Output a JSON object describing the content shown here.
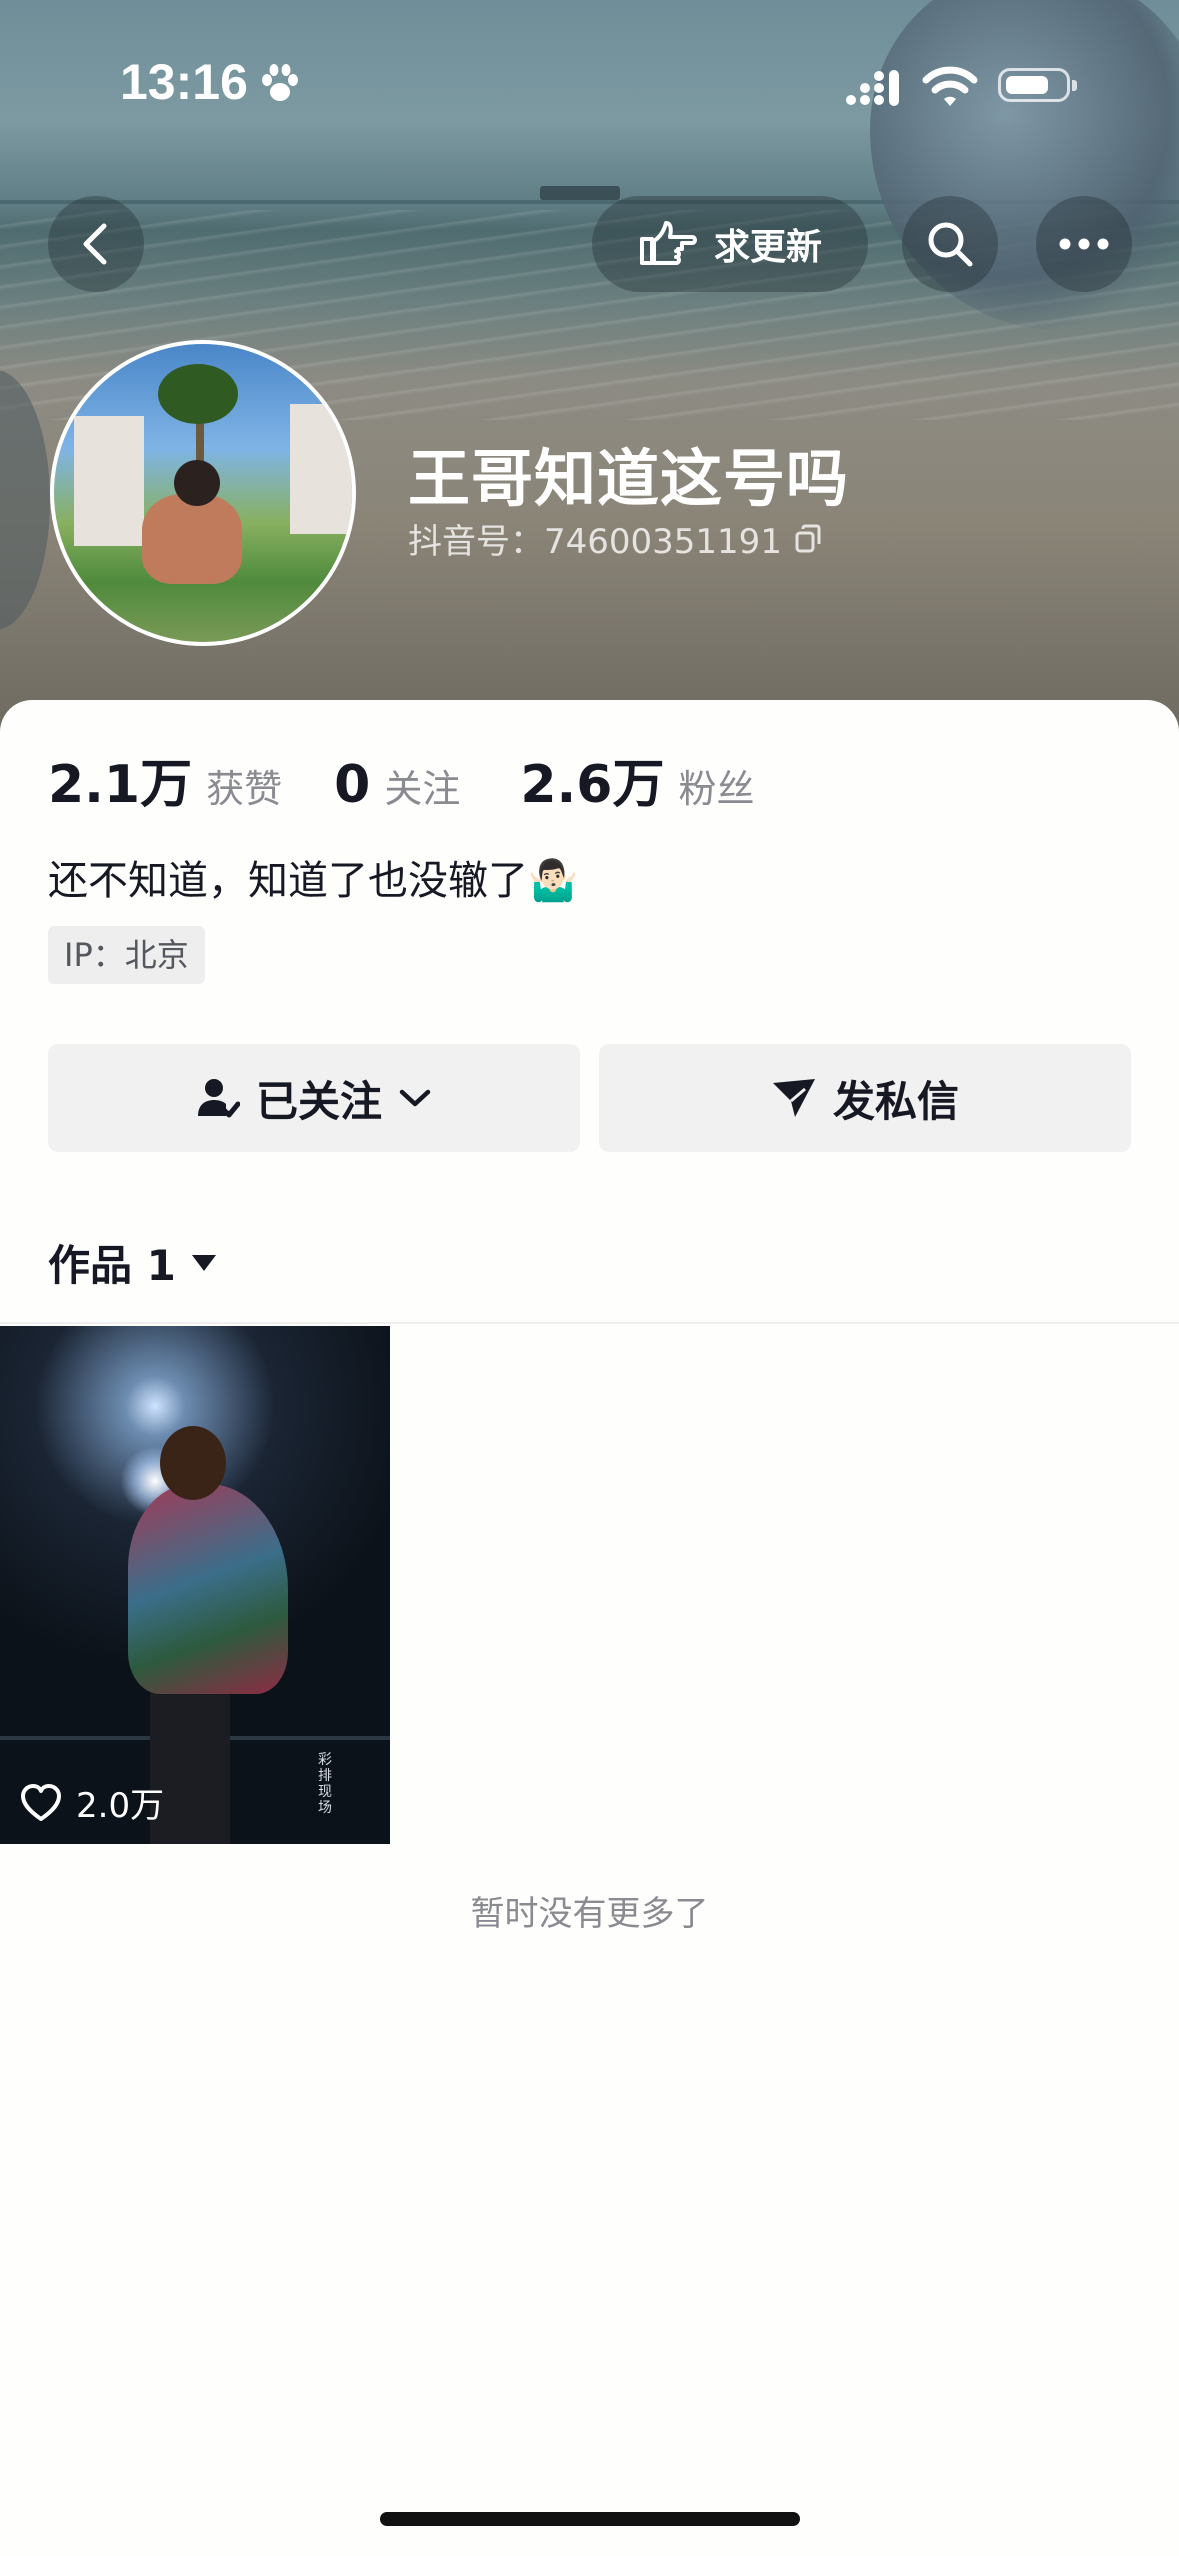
{
  "status_bar": {
    "time": "13:16"
  },
  "header": {
    "request_update_label": "求更新",
    "profile_name": "王哥知道这号吗",
    "douyin_id": "抖音号：74600351191"
  },
  "stats": [
    {
      "value": "2.1万",
      "label": "获赞"
    },
    {
      "value": "0",
      "label": "关注"
    },
    {
      "value": "2.6万",
      "label": "粉丝"
    }
  ],
  "bio": "还不知道，知道了也没辙了🤷🏻‍♂️",
  "ip_location": "IP：北京",
  "actions": {
    "following_label": "已关注",
    "message_label": "发私信"
  },
  "works_tab": {
    "label": "作品 1"
  },
  "video": {
    "likes": "2.0万",
    "caption": "彩排现场"
  },
  "footer_text": "暂时没有更多了"
}
